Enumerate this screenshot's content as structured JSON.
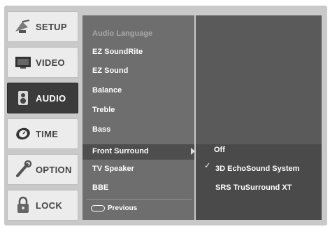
{
  "sidebar": {
    "items": [
      {
        "label": "SETUP",
        "icon": "satellite-dish-icon"
      },
      {
        "label": "VIDEO",
        "icon": "tv-screen-icon"
      },
      {
        "label": "AUDIO",
        "icon": "speaker-icon"
      },
      {
        "label": "TIME",
        "icon": "clock-icon"
      },
      {
        "label": "OPTION",
        "icon": "wrench-icon"
      },
      {
        "label": "LOCK",
        "icon": "padlock-icon"
      }
    ],
    "active": "AUDIO"
  },
  "menu": {
    "items": [
      {
        "label": "Audio Language",
        "disabled": true
      },
      {
        "label": "EZ SoundRite"
      },
      {
        "label": "EZ Sound"
      },
      {
        "label": "Balance"
      },
      {
        "label": "Treble"
      },
      {
        "label": "Bass"
      },
      {
        "label": "Front Surround"
      },
      {
        "label": "TV Speaker"
      },
      {
        "label": "BBE"
      }
    ],
    "selected": "Front Surround",
    "previous_label": "Previous"
  },
  "submenu": {
    "options": [
      "Off",
      "3D EchoSound System",
      "SRS TruSurround XT"
    ],
    "checked": "Off",
    "check_mark": "✓"
  }
}
